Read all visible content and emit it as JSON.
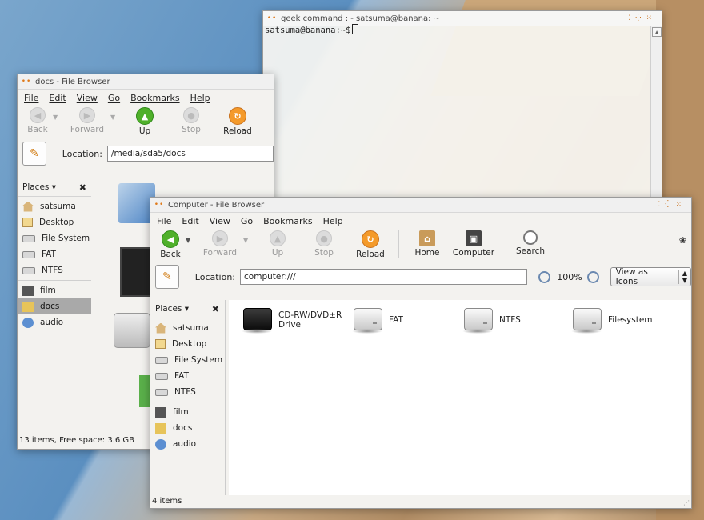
{
  "terminal": {
    "title": "geek command :  - satsuma@banana: ~",
    "prompt": "satsuma@banana:~$"
  },
  "docs_window": {
    "title": "docs - File Browser",
    "menu": [
      "File",
      "Edit",
      "View",
      "Go",
      "Bookmarks",
      "Help"
    ],
    "toolbar": {
      "back": "Back",
      "forward": "Forward",
      "up": "Up",
      "stop": "Stop",
      "reload": "Reload"
    },
    "location_label": "Location:",
    "location_value": "/media/sda5/docs",
    "places_label": "Places",
    "places": [
      "satsuma",
      "Desktop",
      "File System",
      "FAT",
      "NTFS"
    ],
    "bookmarks": [
      "film",
      "docs",
      "audio"
    ],
    "selected": "docs",
    "status": "13 items, Free space: 3.6 GB"
  },
  "computer_window": {
    "title": "Computer - File Browser",
    "menu": [
      "File",
      "Edit",
      "View",
      "Go",
      "Bookmarks",
      "Help"
    ],
    "toolbar": {
      "back": "Back",
      "forward": "Forward",
      "up": "Up",
      "stop": "Stop",
      "reload": "Reload",
      "home": "Home",
      "computer": "Computer",
      "search": "Search"
    },
    "location_label": "Location:",
    "location_value": "computer:///",
    "zoom": "100%",
    "view_mode": "View as Icons",
    "places_label": "Places",
    "places": [
      "satsuma",
      "Desktop",
      "File System",
      "FAT",
      "NTFS"
    ],
    "bookmarks": [
      "film",
      "docs",
      "audio"
    ],
    "items": [
      {
        "label": "CD-RW/DVD±R Drive",
        "icon": "optical-drive-icon"
      },
      {
        "label": "FAT",
        "icon": "hard-disk-icon"
      },
      {
        "label": "NTFS",
        "icon": "hard-disk-icon"
      },
      {
        "label": "Filesystem",
        "icon": "hard-disk-icon"
      }
    ],
    "status": "4 items"
  }
}
